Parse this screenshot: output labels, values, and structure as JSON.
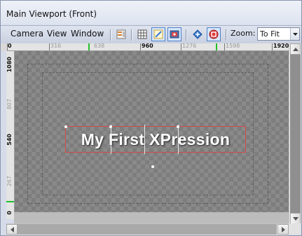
{
  "window": {
    "title": "Main Viewport (Front)"
  },
  "menu": {
    "camera": "Camera",
    "view": "View",
    "window": "Window"
  },
  "toolbar": {
    "buttons": [
      {
        "name": "layout-icon",
        "active": false
      },
      {
        "name": "grid-icon",
        "active": false
      },
      {
        "name": "safe-area-icon",
        "active": true
      },
      {
        "name": "render-preview-icon",
        "active": true
      },
      {
        "name": "camera-nav-icon",
        "active": false
      },
      {
        "name": "output-icon",
        "active": true
      }
    ],
    "zoom_label": "Zoom:",
    "zoom_value": "To Fit"
  },
  "ruler_top": {
    "labels": [
      "0",
      "316",
      "638",
      "960",
      "1276",
      "1598",
      "1920"
    ],
    "highlighted": [
      "0",
      "960",
      "1920"
    ]
  },
  "ruler_left": {
    "labels": [
      "1080",
      "807",
      "540",
      "267",
      "0"
    ],
    "highlighted": [
      "1080",
      "540",
      "0"
    ]
  },
  "scene": {
    "text_object": "My First XPression"
  },
  "colors": {
    "selection": "#d64a4a",
    "active_button_border": "#4f81c9",
    "ruler_marker": "#22c02a"
  }
}
